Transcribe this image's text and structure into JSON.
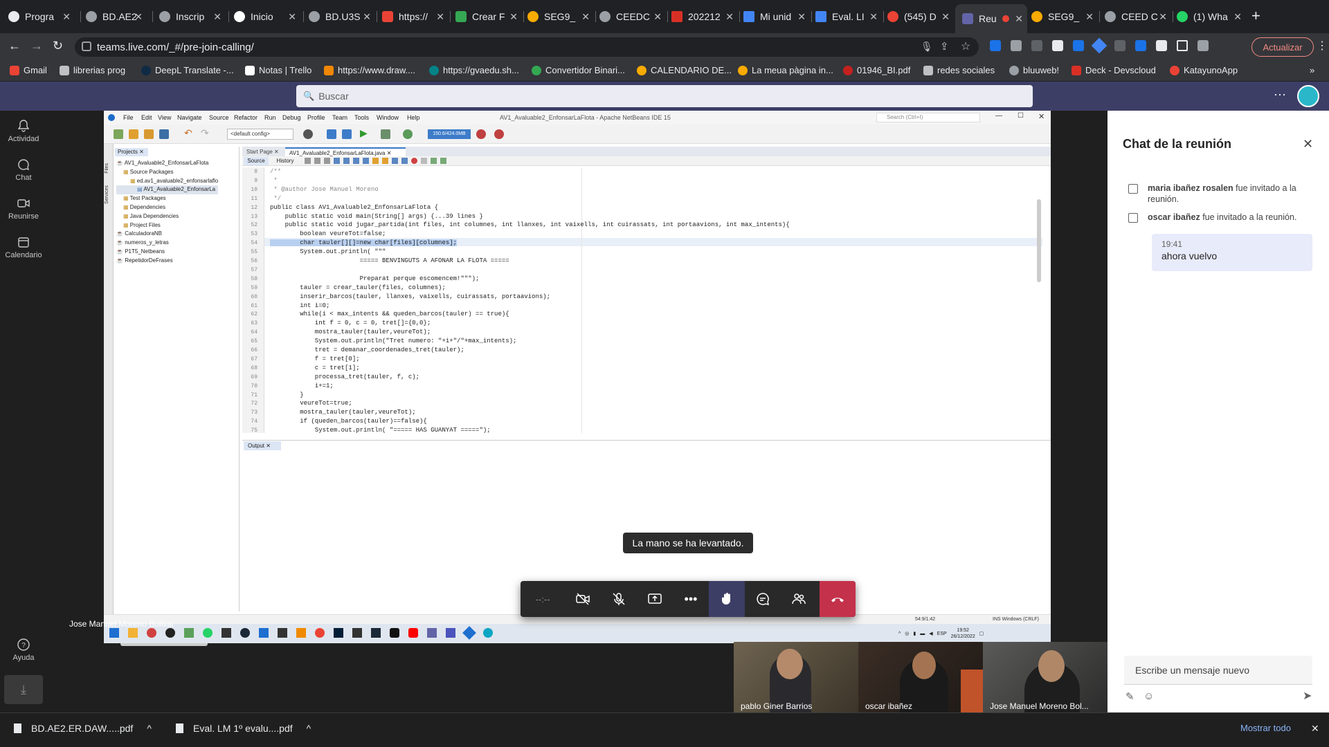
{
  "browser": {
    "tabs": [
      {
        "label": "Progra"
      },
      {
        "label": "BD.AE2"
      },
      {
        "label": "Inscrip"
      },
      {
        "label": "Inicio"
      },
      {
        "label": "BD.U3S"
      },
      {
        "label": "https://"
      },
      {
        "label": "Crear F"
      },
      {
        "label": "SEG9_"
      },
      {
        "label": "CEEDC"
      },
      {
        "label": "202212"
      },
      {
        "label": "Mi unid"
      },
      {
        "label": "Eval. LI"
      },
      {
        "label": "(545) D"
      },
      {
        "label": "Reu"
      },
      {
        "label": "SEG9_"
      },
      {
        "label": "CEED C"
      },
      {
        "label": "(1) Wha"
      }
    ],
    "url": "teams.live.com/_#/pre-join-calling/",
    "update_button": "Actualizar",
    "bookmarks": [
      "Gmail",
      "librerias prog",
      "DeepL Translate -...",
      "Notas | Trello",
      "https://www.draw....",
      "https://gvaedu.sh...",
      "Convertidor Binari...",
      "CALENDARIO DE...",
      "La meua pàgina in...",
      "01946_BI.pdf",
      "redes sociales",
      "bluuweb!",
      "Deck - Devscloud",
      "KatayunoApp"
    ]
  },
  "teams": {
    "search_placeholder": "Buscar",
    "rail": [
      {
        "label": "Actividad"
      },
      {
        "label": "Chat"
      },
      {
        "label": "Reunirse"
      },
      {
        "label": "Calendario"
      }
    ],
    "help": "Ayuda",
    "presenter_label": "Jose Manuel Moreno Bolivar",
    "toast": "La mano se ha levantado.",
    "call_timer": "--:--",
    "participants": [
      {
        "name": "pablo Giner Barrios"
      },
      {
        "name": "oscar ibañez"
      },
      {
        "name": "Jose Manuel Moreno Bol..."
      }
    ]
  },
  "netbeans": {
    "title": "AV1_Avaluable2_EnfonsarLaFlota - Apache NetBeans IDE 15",
    "menu": [
      "File",
      "Edit",
      "View",
      "Navigate",
      "Source",
      "Refactor",
      "Run",
      "Debug",
      "Profile",
      "Team",
      "Tools",
      "Window",
      "Help"
    ],
    "search": "Search (Ctrl+I)",
    "config": "<default config>",
    "memory": "150.6/424.0MB",
    "projects_tab": "Projects",
    "side_tabs": [
      "Files",
      "Services"
    ],
    "tree": [
      "AV1_Avaluable2_EnfonsarLaFlota",
      "Source Packages",
      "ed.av1_avaluable2_enfonsarlaflo",
      "AV1_Avaluable2_EnfonsarLa",
      "Test Packages",
      "Dependencies",
      "Java Dependencies",
      "Project Files",
      "CalculadoraNB",
      "numeros_y_letras",
      "P1T5_Netbeans",
      "RepetidorDeFrases"
    ],
    "editor_tabs": [
      "Start Page",
      "AV1_Avaluable2_EnfonsarLaFlota.java"
    ],
    "source_tab": "Source",
    "history_tab": "History",
    "line_numbers": [
      "8",
      "9",
      "10",
      "11",
      "12",
      "13",
      "52",
      "53",
      "54",
      "55",
      "56",
      "57",
      "58",
      "59",
      "60",
      "61",
      "62",
      "63",
      "64",
      "65",
      "66",
      "67",
      "68",
      "69",
      "70",
      "71",
      "72",
      "73",
      "74",
      "75"
    ],
    "code": [
      "/**",
      " *",
      " * @author Jose Manuel Moreno",
      " */",
      "public class AV1_Avaluable2_EnfonsarLaFlota {",
      "    public static void main(String[] args) {...39 lines }",
      "    public static void jugar_partida(int files, int columnes, int llanxes, int vaixells, int cuirassats, int portaavions, int max_intents){",
      "        boolean veureTot=false;",
      "        char tauler[][]=new char[files][columnes];",
      "        System.out.println( \"\"\"",
      "                        ===== BENVINGUTS A AFONAR LA FLOTA =====",
      "",
      "                        Preparat perque escomencem!\"\"\");",
      "        tauler = crear_tauler(files, columnes);",
      "        inserir_barcos(tauler, llanxes, vaixells, cuirassats, portaavions);",
      "        int i=0;",
      "        while(i < max_intents && queden_barcos(tauler) == true){",
      "            int f = 0, c = 0, tret[]={0,0};",
      "            mostra_tauler(tauler,veureTot);",
      "            System.out.println(\"Tret numero: \"+i+\"/\"+max_intents);",
      "            tret = demanar_coordenades_tret(tauler);",
      "            f = tret[0];",
      "            c = tret[1];",
      "            processa_tret(tauler, f, c);",
      "            i+=1;",
      "        }",
      "        veureTot=true;",
      "        mostra_tauler(tauler,veureTot);",
      "        if (queden_barcos(tauler)==false){",
      "            System.out.println( \"===== HAS GUANYAT =====\");"
    ],
    "output_tab": "Output",
    "status_pos": "54:9/1:42",
    "status_mode": "INS Windows (CRLF)"
  },
  "windows_tray": {
    "lang": "ESP",
    "time": "19:52",
    "date": "26/12/2022"
  },
  "chat": {
    "title": "Chat de la reunión",
    "events": [
      {
        "name": "maria ibañez rosalen",
        "text": " fue invitado a la reunión."
      },
      {
        "name": "oscar ibañez",
        "text": " fue invitado a la reunión."
      }
    ],
    "message": {
      "time": "19:41",
      "text": "ahora vuelvo"
    },
    "compose_placeholder": "Escribe un mensaje nuevo"
  },
  "downloads": {
    "items": [
      {
        "name": "BD.AE2.ER.DAW.....pdf"
      },
      {
        "name": "Eval. LM 1º evalu....pdf"
      }
    ],
    "show_all": "Mostrar todo"
  },
  "colors": {
    "teams_header": "#3d3e66",
    "accent": "#6264a7",
    "hangup": "#c4314b"
  }
}
